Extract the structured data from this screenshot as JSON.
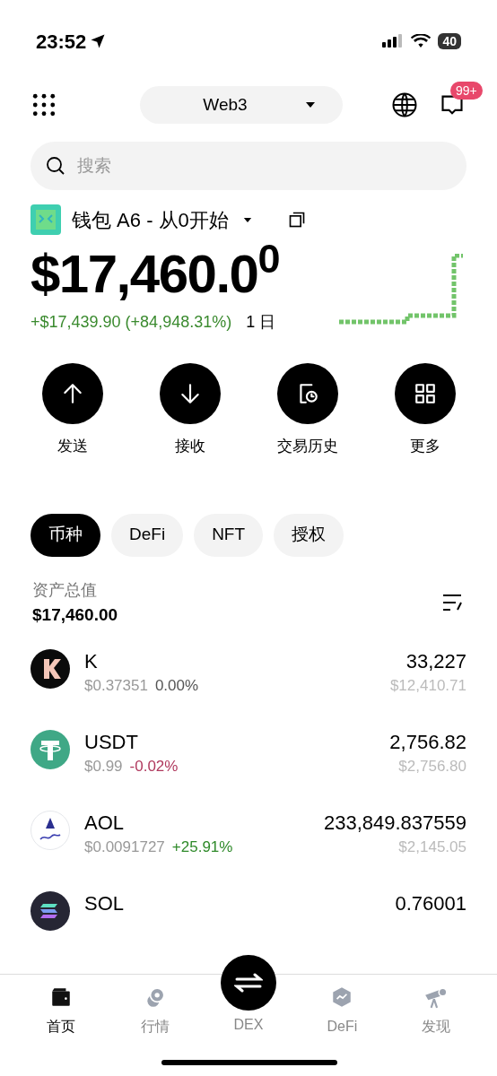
{
  "status_bar": {
    "time": "23:52",
    "battery": "40"
  },
  "header": {
    "network": "Web3",
    "badge": "99+"
  },
  "search": {
    "placeholder": "搜索"
  },
  "wallet": {
    "name": "钱包 A6 - 从0开始",
    "balance": "$17,460.0$^{0}$",
    "change": "+$17,439.90 (+84,948.31%)",
    "period": "1 日"
  },
  "actions": [
    {
      "kind": "send",
      "label": "发送"
    },
    {
      "kind": "receive",
      "label": "接收"
    },
    {
      "kind": "history",
      "label": "交易历史"
    },
    {
      "kind": "more",
      "label": "更多"
    }
  ],
  "tabs": [
    {
      "label": "币种",
      "selected": true
    },
    {
      "label": "DeFi",
      "selected": false
    },
    {
      "label": "NFT",
      "selected": false
    },
    {
      "label": "授权",
      "selected": false
    }
  ],
  "total": {
    "label": "资产总值",
    "value": "$17,460.00"
  },
  "tokens": [
    {
      "kind": "k",
      "symbol": "K",
      "price": "$0.37351",
      "change": "0.00%",
      "color": "#555555",
      "amount": "33,227",
      "value": "$12,410.71"
    },
    {
      "kind": "usdt",
      "symbol": "USDT",
      "price": "$0.99",
      "change": "-0.02%",
      "color": "#b0395e",
      "amount": "2,756.82",
      "value": "$2,756.80"
    },
    {
      "kind": "aol",
      "symbol": "AOL",
      "price": "$0.0091727",
      "change": "+25.91%",
      "color": "#2f8a2a",
      "amount": "233,849.837559",
      "value": "$2,145.05"
    },
    {
      "kind": "sol",
      "symbol": "SOL",
      "amount": "0.76001"
    }
  ],
  "nav": [
    {
      "kind": "home",
      "label": "首页",
      "selected": true
    },
    {
      "kind": "market",
      "label": "行情",
      "selected": false
    },
    {
      "kind": "dex",
      "label": "DEX",
      "selected": false
    },
    {
      "kind": "defi",
      "label": "DeFi",
      "selected": false
    },
    {
      "kind": "discover",
      "label": "发现",
      "selected": false
    }
  ]
}
